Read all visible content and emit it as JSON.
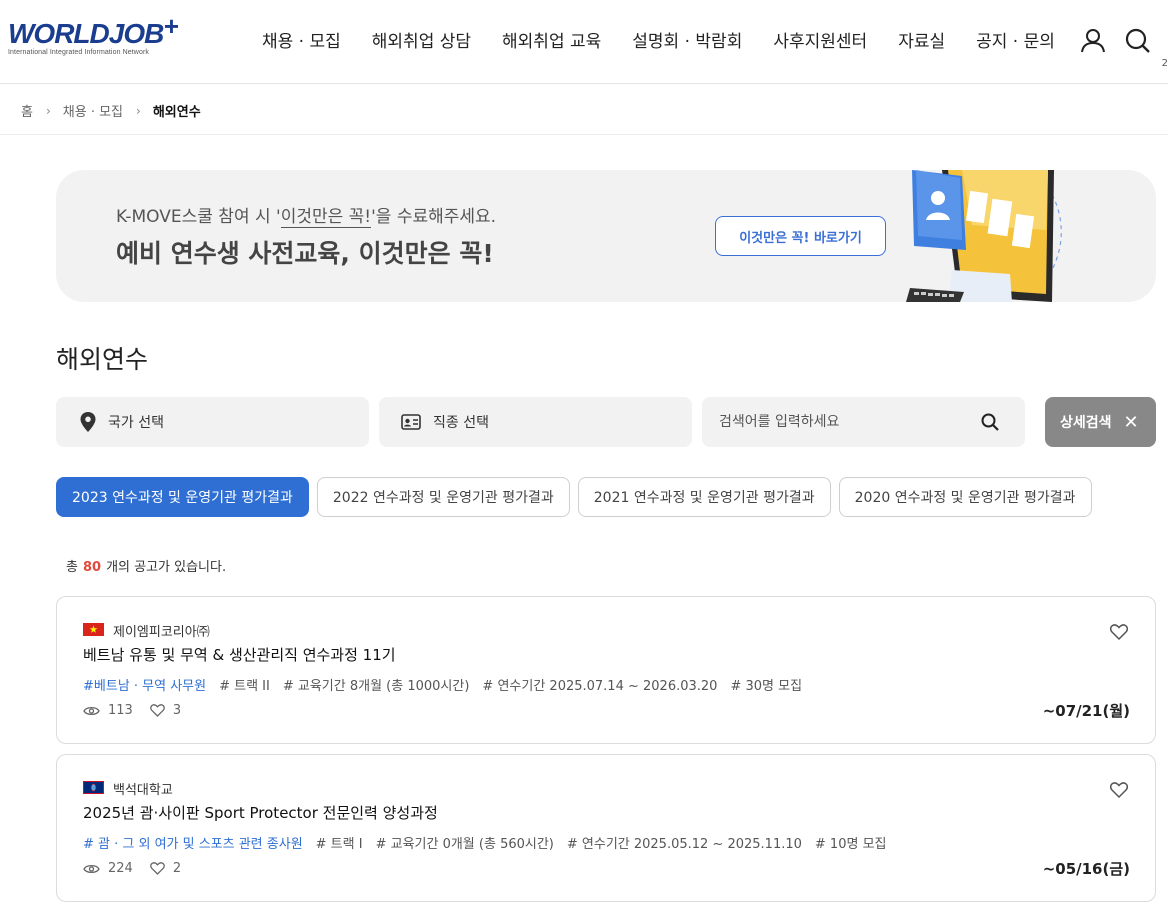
{
  "header": {
    "logo_text": "WORLDJOB",
    "logo_plus": "+",
    "logo_sub": "International Integrated Information Network",
    "nav": [
      "채용 · 모집",
      "해외취업 상담",
      "해외취업 교육",
      "설명회 · 박람회",
      "사후지원센터",
      "자료실",
      "공지 · 문의"
    ],
    "icons": [
      "user-icon",
      "search-icon"
    ],
    "page_num": "2"
  },
  "breadcrumb": {
    "home": "홈",
    "level1": "채용 · 모집",
    "current": "해외연수"
  },
  "banner": {
    "sub_prefix": "K-MOVE스쿨 참여 시 '",
    "sub_highlight": "이것만은 꼭!",
    "sub_suffix": "'을 수료해주세요.",
    "title": "예비 연수생 사전교육, 이것만은 꼭!",
    "button": "이것만은 꼭! 바로가기"
  },
  "section_title": "해외연수",
  "search": {
    "country": "국가 선택",
    "job": "직종 선택",
    "keyword_placeholder": "검색어를 입력하세요",
    "advanced": "상세검색"
  },
  "tabs": [
    "2023 연수과정 및 운영기관 평가결과",
    "2022 연수과정 및 운영기관 평가결과",
    "2021 연수과정 및 운영기관 평가결과",
    "2020 연수과정 및 운영기관 평가결과"
  ],
  "count": {
    "prefix": "총",
    "value": "80",
    "suffix": "개의 공고가 있습니다."
  },
  "listings": [
    {
      "flag": "vietnam-flag",
      "company": "제이엠피코리아㈜",
      "title": "베트남 유통 및 무역 & 생산관리직 연수과정 11기",
      "tags": [
        "#베트남 · 무역 사무원",
        "# 트랙 II",
        "# 교육기간 8개월 (총 1000시간)",
        "# 연수기간 2025.07.14 ~ 2026.03.20",
        "# 30명 모집"
      ],
      "views": "113",
      "likes": "3",
      "deadline": "~07/21(월)"
    },
    {
      "flag": "guam-flag",
      "company": "백석대학교",
      "title": "2025년 괌·사이판 Sport Protector 전문인력 양성과정",
      "tags": [
        "# 괌 · 그 외 여가 및 스포츠 관련 종사원",
        "# 트랙 I",
        "# 교육기간 0개월 (총 560시간)",
        "# 연수기간 2025.05.12 ~ 2025.11.10",
        "# 10명 모집"
      ],
      "views": "224",
      "likes": "2",
      "deadline": "~05/16(금)"
    }
  ],
  "colors": {
    "accent": "#2f6fd3",
    "count_red": "#e04b3f",
    "logo_blue": "#1a3d8f",
    "banner_bg": "#f2f2f2"
  }
}
